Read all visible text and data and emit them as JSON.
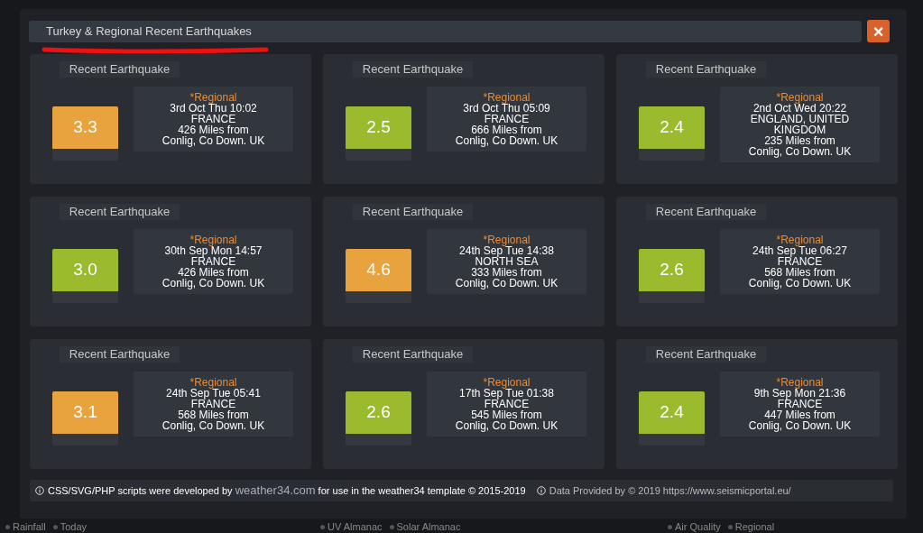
{
  "background": {
    "bottom_tabs": [
      {
        "items": [
          "Rainfall",
          "Today"
        ]
      },
      {
        "items": [
          "UV Almanac",
          "Solar Almanac"
        ]
      },
      {
        "items": [
          "Air Quality",
          "Regional"
        ]
      }
    ]
  },
  "modal": {
    "title": "Turkey & Regional Recent Earthquakes",
    "close": "×",
    "quakes": [
      {
        "heading": "Recent Earthquake",
        "magnitude": "3.3",
        "color": "#e8a23e",
        "tag": "*Regional",
        "when": "3rd Oct Thu 10:02",
        "region": "FRANCE",
        "distance": "426 Miles from",
        "place": "Conlig, Co Down. UK"
      },
      {
        "heading": "Recent Earthquake",
        "magnitude": "2.5",
        "color": "#9bbb2f",
        "tag": "*Regional",
        "when": "3rd Oct Thu 05:09",
        "region": "FRANCE",
        "distance": "666 Miles from",
        "place": "Conlig, Co Down. UK"
      },
      {
        "heading": "Recent Earthquake",
        "magnitude": "2.4",
        "color": "#9bbb2f",
        "tag": "*Regional",
        "when": "2nd Oct Wed 20:22",
        "region": "ENGLAND, UNITED KINGDOM",
        "distance": "235 Miles from",
        "place": "Conlig, Co Down. UK"
      },
      {
        "heading": "Recent Earthquake",
        "magnitude": "3.0",
        "color": "#9bbb2f",
        "tag": "*Regional",
        "when": "30th Sep Mon 14:57",
        "region": "FRANCE",
        "distance": "426 Miles from",
        "place": "Conlig, Co Down. UK"
      },
      {
        "heading": "Recent Earthquake",
        "magnitude": "4.6",
        "color": "#e8a23e",
        "tag": "*Regional",
        "when": "24th Sep Tue 14:38",
        "region": "NORTH SEA",
        "distance": "333 Miles from",
        "place": "Conlig, Co Down. UK"
      },
      {
        "heading": "Recent Earthquake",
        "magnitude": "2.6",
        "color": "#9bbb2f",
        "tag": "*Regional",
        "when": "24th Sep Tue 06:27",
        "region": "FRANCE",
        "distance": "568 Miles from",
        "place": "Conlig, Co Down. UK"
      },
      {
        "heading": "Recent Earthquake",
        "magnitude": "3.1",
        "color": "#e8a23e",
        "tag": "*Regional",
        "when": "24th Sep Tue 05:41",
        "region": "FRANCE",
        "distance": "568 Miles from",
        "place": "Conlig, Co Down. UK"
      },
      {
        "heading": "Recent Earthquake",
        "magnitude": "2.6",
        "color": "#9bbb2f",
        "tag": "*Regional",
        "when": "17th Sep Tue 01:38",
        "region": "FRANCE",
        "distance": "545 Miles from",
        "place": "Conlig, Co Down. UK"
      },
      {
        "heading": "Recent Earthquake",
        "magnitude": "2.4",
        "color": "#9bbb2f",
        "tag": "*Regional",
        "when": "9th Sep Mon 21:36",
        "region": "FRANCE",
        "distance": "447 Miles from",
        "place": "Conlig, Co Down. UK"
      }
    ],
    "footer": {
      "credit_before": "CSS/SVG/PHP scripts were developed by",
      "credit_link": "weather34.com",
      "credit_after": "for use in the weather34 template © 2015-2019",
      "source": "Data Provided by © 2019 https://www.seismicportal.eu/"
    }
  }
}
